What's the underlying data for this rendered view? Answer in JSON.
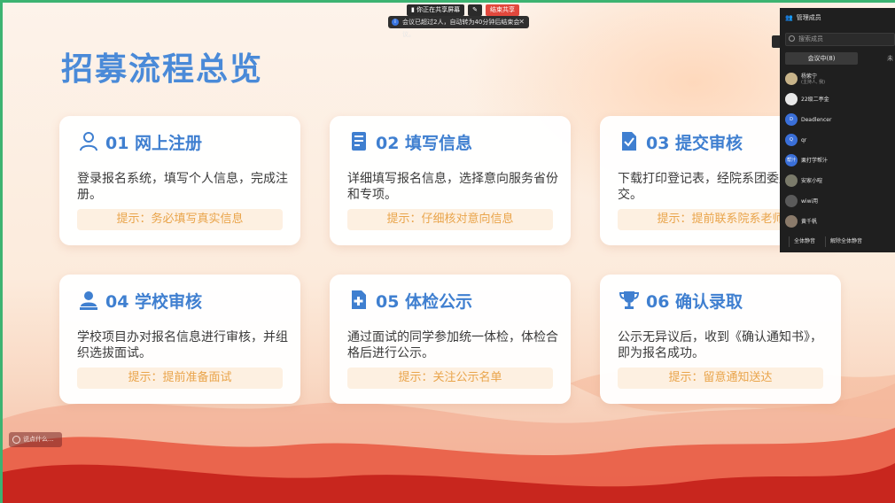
{
  "slide": {
    "title": "招募流程总览",
    "cards": [
      {
        "title": "01 网上注册",
        "icon": "person-icon",
        "desc": "登录报名系统，填写个人信息，完成注册。",
        "tip": "提示：务必填写真实信息"
      },
      {
        "title": "02 填写信息",
        "icon": "form-icon",
        "desc": "详细填写报名信息，选择意向服务省份和专项。",
        "tip": "提示：仔细核对意向信息"
      },
      {
        "title": "03 提交审核",
        "icon": "check-document-icon",
        "desc": "下载打印登记表，经院系团委盖章后提交。",
        "tip": "提示：提前联系院系老师"
      },
      {
        "title": "04 学校审核",
        "icon": "user-review-icon",
        "desc": "学校项目办对报名信息进行审核，并组织选拔面试。",
        "tip": "提示：提前准备面试"
      },
      {
        "title": "05 体检公示",
        "icon": "medical-add-icon",
        "desc": "通过面试的同学参加统一体检，体检合格后进行公示。",
        "tip": "提示：关注公示名单"
      },
      {
        "title": "06 确认录取",
        "icon": "trophy-icon",
        "desc": "公示无异议后，收到《确认通知书》，即为报名成功。",
        "tip": "提示：留意通知送达"
      }
    ]
  },
  "meeting": {
    "share_status": "你正在共享屏幕",
    "stop_share": "结束共享",
    "notice": "会议已超过2人，自动转为40分钟后结束会议。",
    "chat_placeholder": "说点什么..."
  },
  "panel": {
    "title": "管理成员",
    "search_placeholder": "搜索成员",
    "tabs": [
      "会议中(8)",
      "未"
    ],
    "members": [
      {
        "name": "杨紫宁",
        "sub": "(主持人, 我)",
        "avatar": "avatar-photo"
      },
      {
        "name": "22级二亭金",
        "sub": "",
        "avatar": "avatar-photo"
      },
      {
        "name": "Deadlencer",
        "sub": "",
        "avatar": "D"
      },
      {
        "name": "qr",
        "sub": "",
        "avatar": "Q"
      },
      {
        "name": "栗打学帮汁",
        "sub": "",
        "avatar": "帮汁"
      },
      {
        "name": "安家小暄",
        "sub": "",
        "avatar": "avatar-photo"
      },
      {
        "name": "wiwi用",
        "sub": "",
        "avatar": "avatar-photo"
      },
      {
        "name": "黄千帆",
        "sub": "",
        "avatar": "avatar-photo"
      }
    ],
    "footer": [
      "全体静音",
      "解除全体静音"
    ]
  },
  "colors": {
    "title_blue": "#4a8ad8",
    "tip_orange": "#e9a44a",
    "stop_red": "#e2483d"
  }
}
